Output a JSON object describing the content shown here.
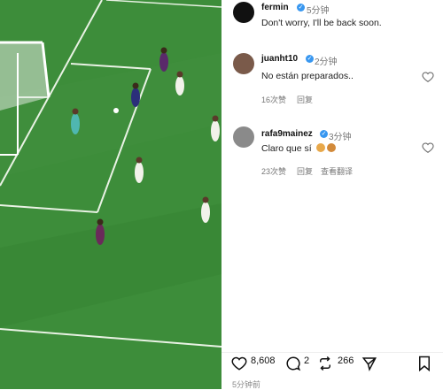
{
  "post": {
    "author": "fermin",
    "time": "5分钟",
    "caption": "Don't worry, I'll be back soon."
  },
  "comments": [
    {
      "user": "juanht10",
      "time": "2分钟",
      "text": "No están preparados..",
      "likes": "16次赞",
      "reply": "回复"
    },
    {
      "user": "rafa9mainez",
      "time": "3分钟",
      "text": "Claro que sí",
      "likes": "23次赞",
      "reply": "回复",
      "translate": "查看翻译"
    }
  ],
  "actions": {
    "likes": "8,608",
    "comments": "2",
    "reposts": "266"
  },
  "footer_time": "5分钟前",
  "colors": {
    "verified": "#3897f0",
    "pitch": "#3a8a37"
  },
  "icons": [
    "heart-icon",
    "comment-icon",
    "repost-icon",
    "share-icon",
    "bookmark-icon"
  ]
}
